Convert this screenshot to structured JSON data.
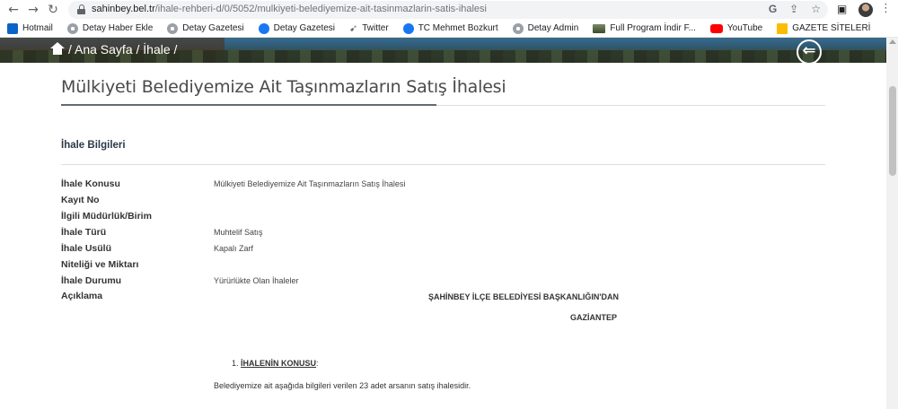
{
  "browser": {
    "url_host": "sahinbey.bel.tr",
    "url_path": "/ihale-rehberi-d/0/5052/mulkiyeti-belediyemize-ait-tasinmazlarin-satis-ihalesi"
  },
  "bookmarks": [
    {
      "label": "Hotmail",
      "icon": "outlook-icon"
    },
    {
      "label": "Detay Haber Ekle",
      "icon": "globe-icon"
    },
    {
      "label": "Detay Gazetesi",
      "icon": "globe-icon"
    },
    {
      "label": "Detay Gazetesi",
      "icon": "facebook-icon"
    },
    {
      "label": "Twitter",
      "icon": "twitter-icon"
    },
    {
      "label": "TC Mehmet Bozkurt",
      "icon": "facebook-icon"
    },
    {
      "label": "Detay Admin",
      "icon": "globe-icon"
    },
    {
      "label": "Full Program İndir F...",
      "icon": "image-icon"
    },
    {
      "label": "YouTube",
      "icon": "youtube-icon"
    },
    {
      "label": "GAZETE SİTELERİ",
      "icon": "folder-icon"
    }
  ],
  "banner": {
    "breadcrumb": "/ Ana Sayfa / İhale /"
  },
  "page": {
    "title": "Mülkiyeti Belediyemize Ait Taşınmazların Satış İhalesi",
    "section_title": "İhale Bilgileri"
  },
  "details": {
    "rows": [
      {
        "label": "İhale Konusu",
        "value": "Mülkiyeti Belediyemize Ait Taşınmazların Satış İhalesi"
      },
      {
        "label": "Kayıt No",
        "value": ""
      },
      {
        "label": "İlgili Müdürlük/Birim",
        "value": ""
      },
      {
        "label": "İhale Türü",
        "value": "Muhtelif Satış"
      },
      {
        "label": "İhale Usülü",
        "value": "Kapalı Zarf"
      },
      {
        "label": "Niteliği ve Miktarı",
        "value": ""
      },
      {
        "label": "İhale Durumu",
        "value": "Yürürlükte Olan İhaleler"
      },
      {
        "label": "Açıklama",
        "value": ""
      }
    ]
  },
  "description": {
    "heading": "ŞAHİNBEY İLÇE BELEDİYESİ BAŞKANLIĞIN'DAN",
    "city": "GAZİANTEP",
    "item_number": "1.",
    "item_title": "İHALENİN KONUSU",
    "item_suffix": ":",
    "paragraph": "Belediyemize ait aşağıda bilgileri verilen 23 adet arsanın satış ihalesidir."
  },
  "colors": {
    "title_rule": "#5f6b78",
    "section_title": "#2a3a4a"
  }
}
